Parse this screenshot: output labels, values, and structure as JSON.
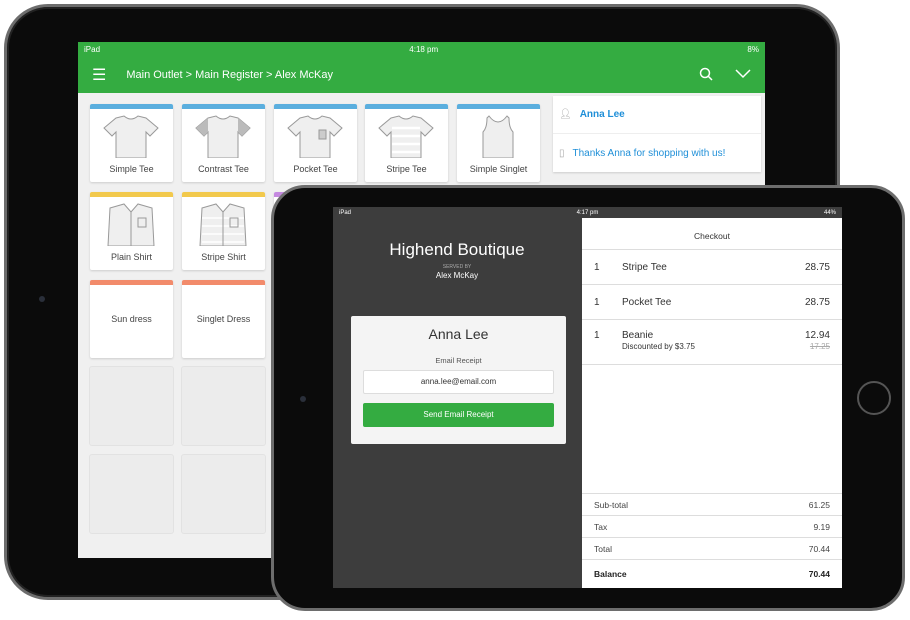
{
  "back_ipad": {
    "status": {
      "carrier": "iPad",
      "time": "4:18 pm",
      "battery": "8%"
    },
    "header": {
      "breadcrumb": "Main Outlet > Main Register > Alex McKay",
      "accent": "#34ac41"
    },
    "products": [
      {
        "label": "Simple Tee",
        "color": "#5aaede",
        "icon": "tshirt-icon"
      },
      {
        "label": "Contrast Tee",
        "color": "#5aaede",
        "icon": "tshirt-contrast-icon"
      },
      {
        "label": "Pocket Tee",
        "color": "#5aaede",
        "icon": "tshirt-pocket-icon"
      },
      {
        "label": "Stripe Tee",
        "color": "#5aaede",
        "icon": "tshirt-stripe-icon"
      },
      {
        "label": "Simple Singlet",
        "color": "#5aaede",
        "icon": "singlet-icon"
      },
      {
        "label": "Plain Shirt",
        "color": "#f2c94c",
        "icon": "shirt-icon"
      },
      {
        "label": "Stripe Shirt",
        "color": "#f2c94c",
        "icon": "shirt-stripe-icon"
      },
      {
        "label": "",
        "color": "#c58ae0",
        "icon": ""
      },
      {
        "label": "Sun dress",
        "color": "#f28b6b",
        "icon": ""
      },
      {
        "label": "Singlet Dress",
        "color": "#f28b6b",
        "icon": ""
      }
    ],
    "customer_panel": {
      "customer": "Anna Lee",
      "note": "Thanks Anna for shopping with us!"
    }
  },
  "front_ipad": {
    "status": {
      "carrier": "iPad",
      "time": "4:17 pm",
      "battery": "44%"
    },
    "store": {
      "name": "Highend Boutique",
      "served_by_label": "SERVED BY",
      "staff": "Alex McKay"
    },
    "receipt_card": {
      "customer": "Anna Lee",
      "email_label": "Email Receipt",
      "email_value": "anna.lee@email.com",
      "send_button": "Send Email Receipt"
    },
    "checkout": {
      "title": "Checkout",
      "items": [
        {
          "qty": "1",
          "name": "Stripe Tee",
          "price": "28.75"
        },
        {
          "qty": "1",
          "name": "Pocket Tee",
          "price": "28.75"
        },
        {
          "qty": "1",
          "name": "Beanie",
          "price": "12.94",
          "discount": "Discounted by $3.75",
          "original_price": "17.25"
        }
      ],
      "totals": [
        {
          "label": "Sub-total",
          "value": "61.25"
        },
        {
          "label": "Tax",
          "value": "9.19"
        },
        {
          "label": "Total",
          "value": "70.44"
        },
        {
          "label": "Balance",
          "value": "70.44"
        }
      ]
    }
  }
}
